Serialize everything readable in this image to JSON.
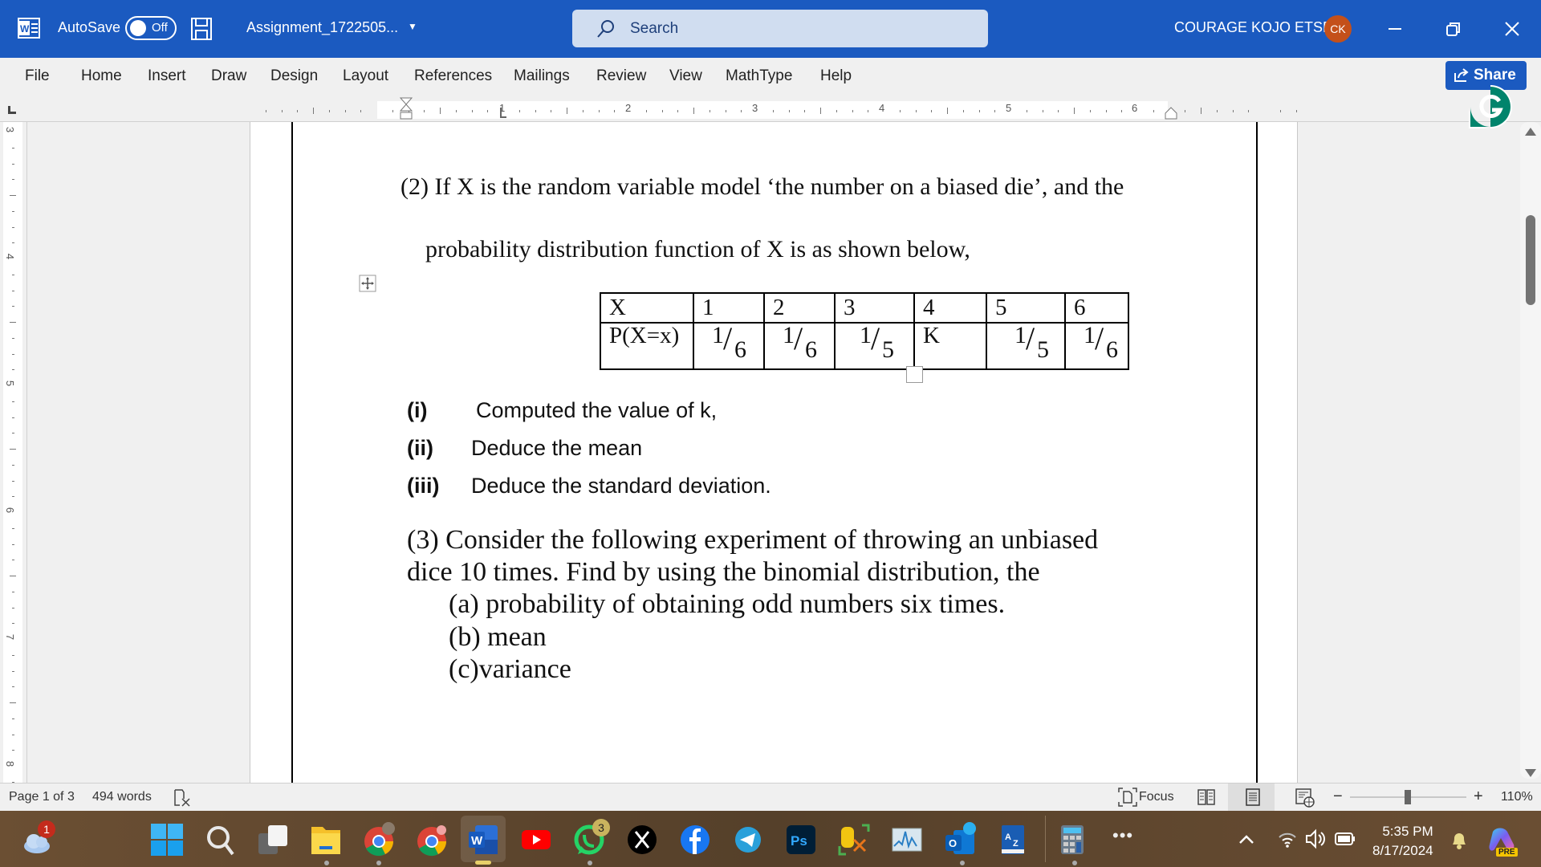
{
  "titlebar": {
    "autosave_label": "AutoSave",
    "autosave_state": "Off",
    "document_name": "Assignment_1722505...",
    "search_placeholder": "Search",
    "user_name": "COURAGE KOJO ETSE",
    "user_initials": "CK",
    "colors": {
      "bar": "#1b5ac0",
      "avatar": "#c4501a"
    }
  },
  "menu": {
    "items": [
      "File",
      "Home",
      "Insert",
      "Draw",
      "Design",
      "Layout",
      "References",
      "Mailings",
      "Review",
      "View",
      "MathType",
      "Help"
    ],
    "share_label": "Share"
  },
  "ruler": {
    "horizontal_numbers": [
      "1",
      "2",
      "3",
      "4",
      "5",
      "6"
    ],
    "vertical_numbers": [
      "3",
      "4",
      "5",
      "6",
      "7",
      "8"
    ]
  },
  "document": {
    "q2_line1": "(2) If X is the random variable model ‘the number on a biased die’, and the",
    "q2_line2": "probability distribution function of X is as shown below,",
    "table": {
      "row1": [
        "X",
        "1",
        "2",
        "3",
        "4",
        "5",
        "6"
      ],
      "row2_label": "P(X=x)",
      "row2": [
        {
          "num": "1",
          "den": "6"
        },
        {
          "num": "1",
          "den": "6"
        },
        {
          "num": "1",
          "den": "5"
        },
        {
          "text": "K"
        },
        {
          "num": "1",
          "den": "5"
        },
        {
          "num": "1",
          "den": "6"
        }
      ]
    },
    "subquestions": [
      {
        "label": "(i)",
        "text": "Computed the value of k,"
      },
      {
        "label": "(ii)",
        "text": "Deduce the mean"
      },
      {
        "label": "(iii)",
        "text": "Deduce the standard deviation."
      }
    ],
    "q3_line1": "(3) Consider the following experiment of throwing an unbiased",
    "q3_line2": "dice 10 times. Find by using the binomial distribution, the",
    "q3_parts": [
      "(a) probability of obtaining odd numbers six times.",
      "(b) mean",
      "(c)variance"
    ]
  },
  "statusbar": {
    "page": "Page 1 of 3",
    "words": "494 words",
    "focus": "Focus",
    "zoom": "110%",
    "zoom_minus": "−",
    "zoom_plus": "+"
  },
  "taskbar": {
    "weather_badge": "1",
    "whatsapp_badge": "3",
    "time": "5:35 PM",
    "date": "8/17/2024",
    "copilot_tag": "PRE"
  }
}
